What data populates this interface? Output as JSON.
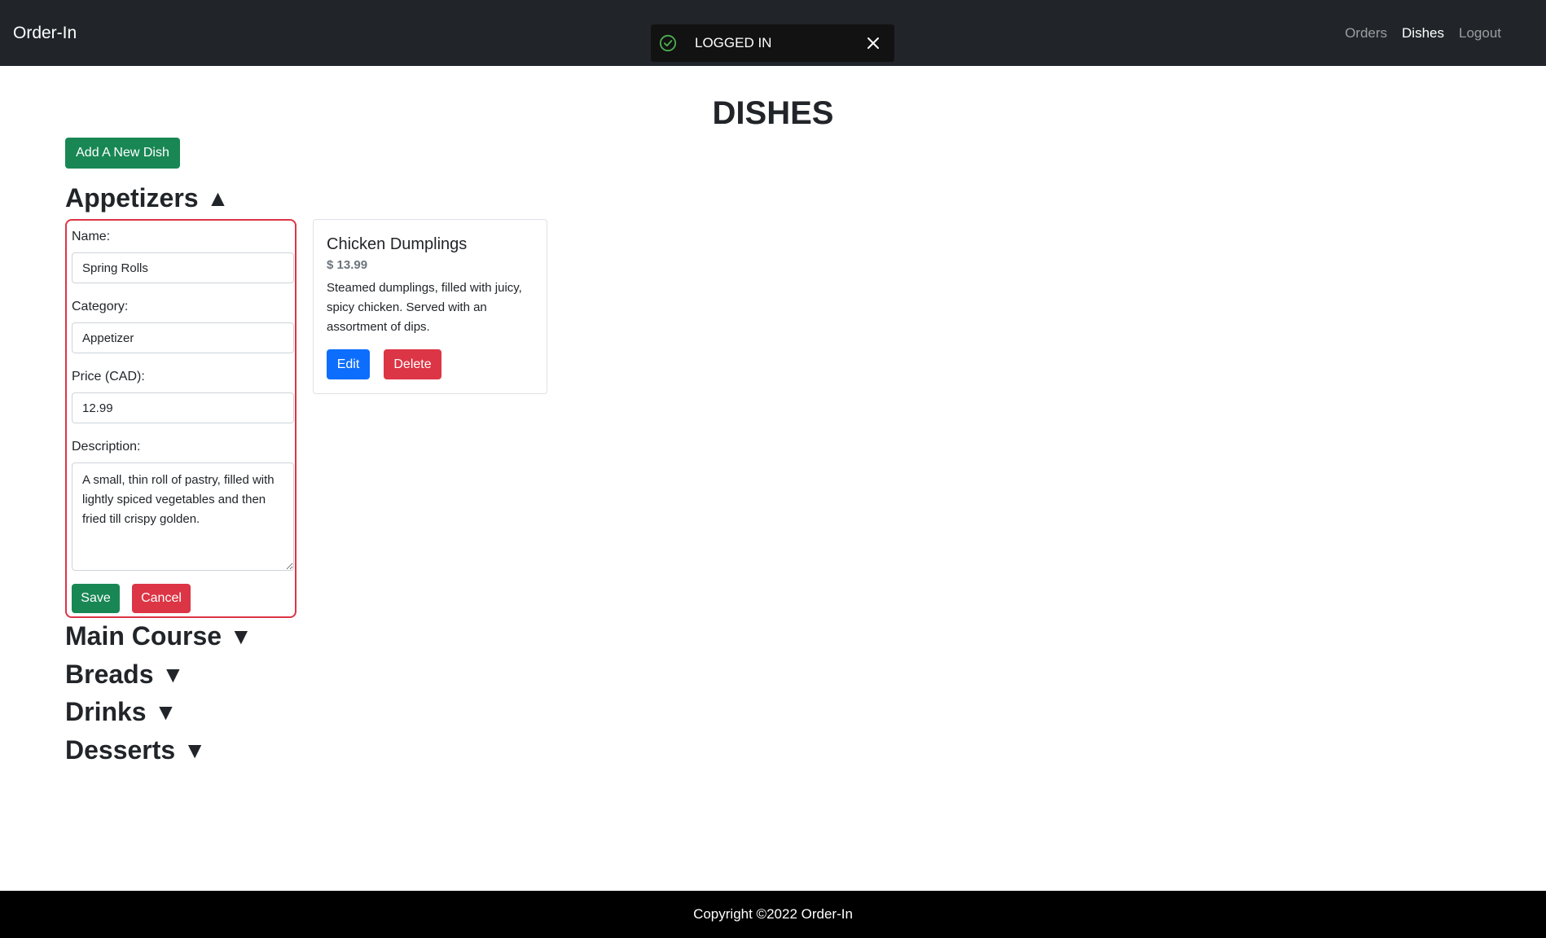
{
  "navbar": {
    "brand": "Order-In",
    "links": [
      {
        "label": "Orders",
        "active": false
      },
      {
        "label": "Dishes",
        "active": true
      },
      {
        "label": "Logout",
        "active": false
      }
    ]
  },
  "toast": {
    "message": "LOGGED IN",
    "icon": "check-circle-icon",
    "icon_color": "#4caf50"
  },
  "page": {
    "title": "DISHES",
    "add_button": "Add A New Dish"
  },
  "sections": {
    "appetizers": {
      "label": "Appetizers",
      "caret": "▲",
      "expanded": true
    },
    "main_course": {
      "label": "Main Course",
      "caret": "▼",
      "expanded": false
    },
    "breads": {
      "label": "Breads",
      "caret": "▼",
      "expanded": false
    },
    "drinks": {
      "label": "Drinks",
      "caret": "▼",
      "expanded": false
    },
    "desserts": {
      "label": "Desserts",
      "caret": "▼",
      "expanded": false
    }
  },
  "edit_form": {
    "name_label": "Name:",
    "name_value": "Spring Rolls",
    "category_label": "Category:",
    "category_value": "Appetizer",
    "price_label": "Price (CAD):",
    "price_value": "12.99",
    "description_label": "Description:",
    "description_value": "A small, thin roll of pastry, filled with lightly spiced vegetables and then fried till crispy golden.",
    "save_label": "Save",
    "cancel_label": "Cancel"
  },
  "dish_card": {
    "name": "Chicken Dumplings",
    "price": "$ 13.99",
    "description": "Steamed dumplings, filled with juicy, spicy chicken. Served with an assortment of dips.",
    "edit_label": "Edit",
    "delete_label": "Delete"
  },
  "footer": {
    "text": "Copyright ©2022 Order-In"
  },
  "colors": {
    "navbar_bg": "#212529",
    "success": "#198754",
    "danger": "#dc3545",
    "primary": "#0d6efd",
    "footer_bg": "#000000"
  }
}
